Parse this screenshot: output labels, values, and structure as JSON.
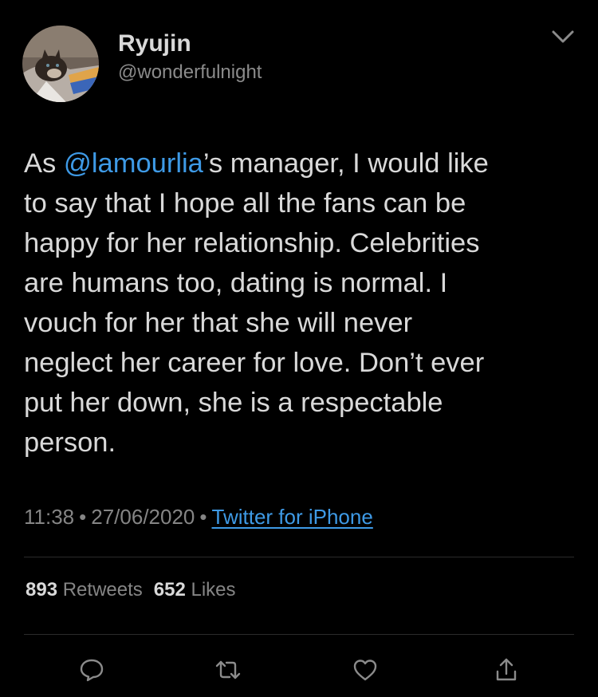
{
  "profile": {
    "display_name": "Ryujin",
    "handle": "@wonderfulnight",
    "avatar_icon": "cat-photo-avatar"
  },
  "menu": {
    "icon": "chevron-down-icon"
  },
  "tweet": {
    "lines": [
      {
        "pre": "As ",
        "mention": "@lamourlia",
        "post": "’s manager, I would like"
      },
      {
        "text": "to say that I hope all the fans can be"
      },
      {
        "text": "happy for her relationship. Celebrities"
      },
      {
        "text": "are humans too, dating is normal. I"
      },
      {
        "text": "vouch for her that she will never"
      },
      {
        "text": "neglect her career for love. Don’t ever"
      },
      {
        "text": "put her down, she is a respectable"
      },
      {
        "text": "person."
      }
    ]
  },
  "meta": {
    "time": "11:38",
    "separator": "•",
    "date": "27/06/2020",
    "source": "Twitter for iPhone"
  },
  "stats": {
    "retweets_count": "893",
    "retweets_label": "Retweets",
    "likes_count": "652",
    "likes_label": "Likes"
  },
  "actions": [
    {
      "name": "reply",
      "icon": "reply-icon"
    },
    {
      "name": "retweet",
      "icon": "retweet-icon"
    },
    {
      "name": "like",
      "icon": "heart-icon"
    },
    {
      "name": "share",
      "icon": "share-icon"
    }
  ],
  "colors": {
    "background": "#000000",
    "text": "#d9d9d9",
    "muted": "#858585",
    "link": "#3e9ae6",
    "divider": "#2b2b2b"
  }
}
